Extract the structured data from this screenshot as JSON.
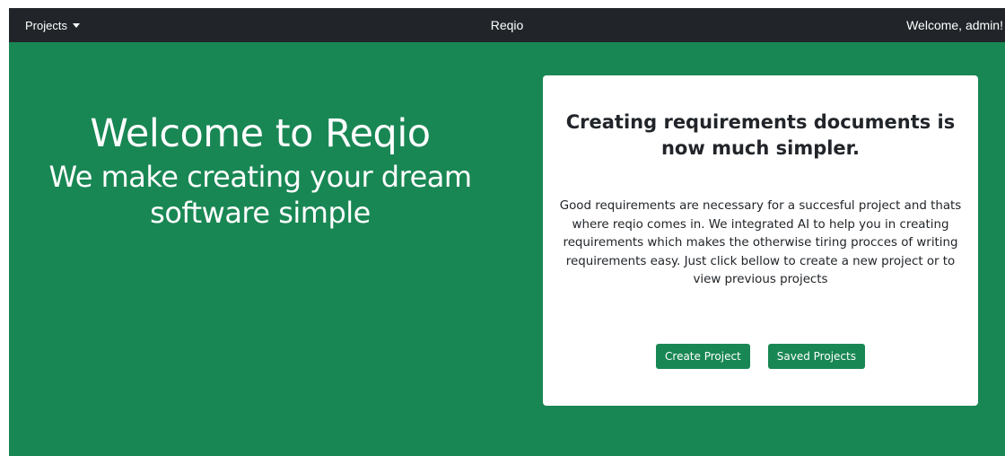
{
  "navbar": {
    "projects_label": "Projects",
    "brand": "Reqio",
    "welcome": "Welcome, admin!"
  },
  "hero": {
    "title": "Welcome to Reqio",
    "subtitle": "We make creating your dream software simple"
  },
  "card": {
    "title": "Creating requirements documents is now much simpler.",
    "text": "Good requirements are necessary for a succesful project and thats where reqio comes in. We integrated AI to help you in creating requirements which makes the otherwise tiring procces of writing requirements easy. Just click bellow to create a new project or to view previous projects",
    "create_button": "Create Project",
    "saved_button": "Saved Projects"
  },
  "colors": {
    "navbar_bg": "#212529",
    "page_bg": "#198754",
    "button_bg": "#198754",
    "card_bg": "#ffffff"
  },
  "icons": {
    "projects_dropdown": "caret-down-icon"
  }
}
